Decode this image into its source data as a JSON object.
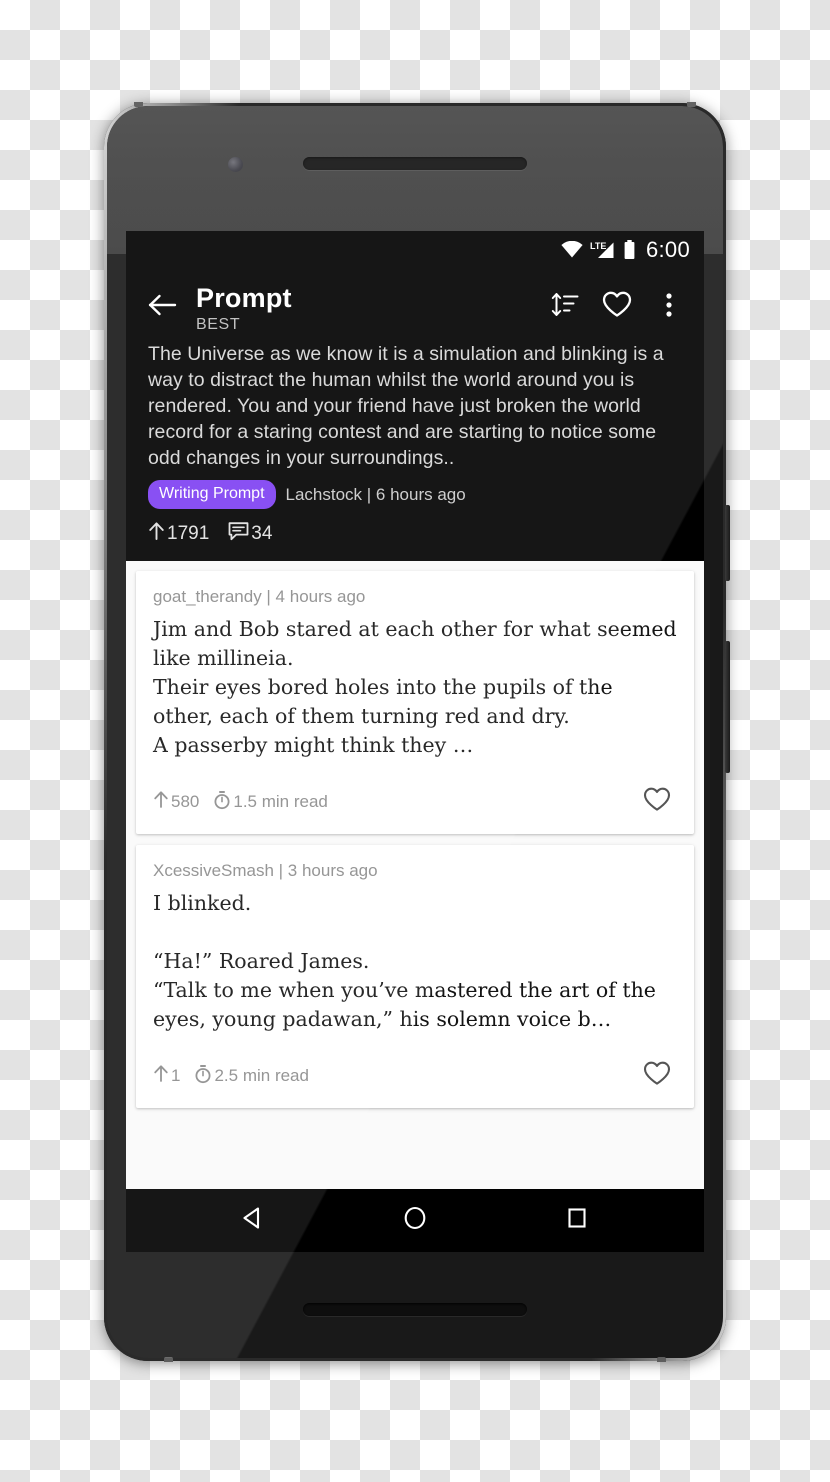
{
  "status_bar": {
    "time": "6:00",
    "network_label": "LTE",
    "icons": [
      "wifi-icon",
      "lte-signal-icon",
      "battery-icon"
    ]
  },
  "app_bar": {
    "back_icon": "back-arrow-icon",
    "title": "Prompt",
    "subtitle": "BEST",
    "actions": [
      {
        "name": "sort-icon",
        "label": "Sort"
      },
      {
        "name": "favorite-icon",
        "label": "Favorite"
      },
      {
        "name": "overflow-menu-icon",
        "label": "More options"
      }
    ]
  },
  "prompt": {
    "text": "The Universe as we know it is a simulation and blinking is a way to distract the human whilst the world around you is rendered. You and your friend have just broken the world record for a staring contest and are starting to notice some odd changes in your surroundings..",
    "flair": "Writing Prompt",
    "flair_color": "#7e3ff2",
    "byline": "Lachstock | 6 hours ago",
    "upvotes": "1791",
    "comments": "34"
  },
  "comments": [
    {
      "byline": "goat_therandy | 4 hours ago",
      "body": "Jim and Bob stared at each other for what seemed like millineia.\nTheir eyes bored holes into the pupils of the other, each of them turning red and dry.\nA passerby might think they …",
      "upvotes": "580",
      "read_time": "1.5 min read"
    },
    {
      "byline": "XcessiveSmash | 3 hours ago",
      "body": "I blinked.\n\n“Ha!” Roared James.\n“Talk to me when you’ve mastered the art of the eyes, young padawan,” his solemn voice b…",
      "upvotes": "1",
      "read_time": "2.5 min read"
    }
  ],
  "nav_bar": {
    "back": "back-triangle-icon",
    "home": "home-circle-icon",
    "recents": "recents-square-icon"
  }
}
